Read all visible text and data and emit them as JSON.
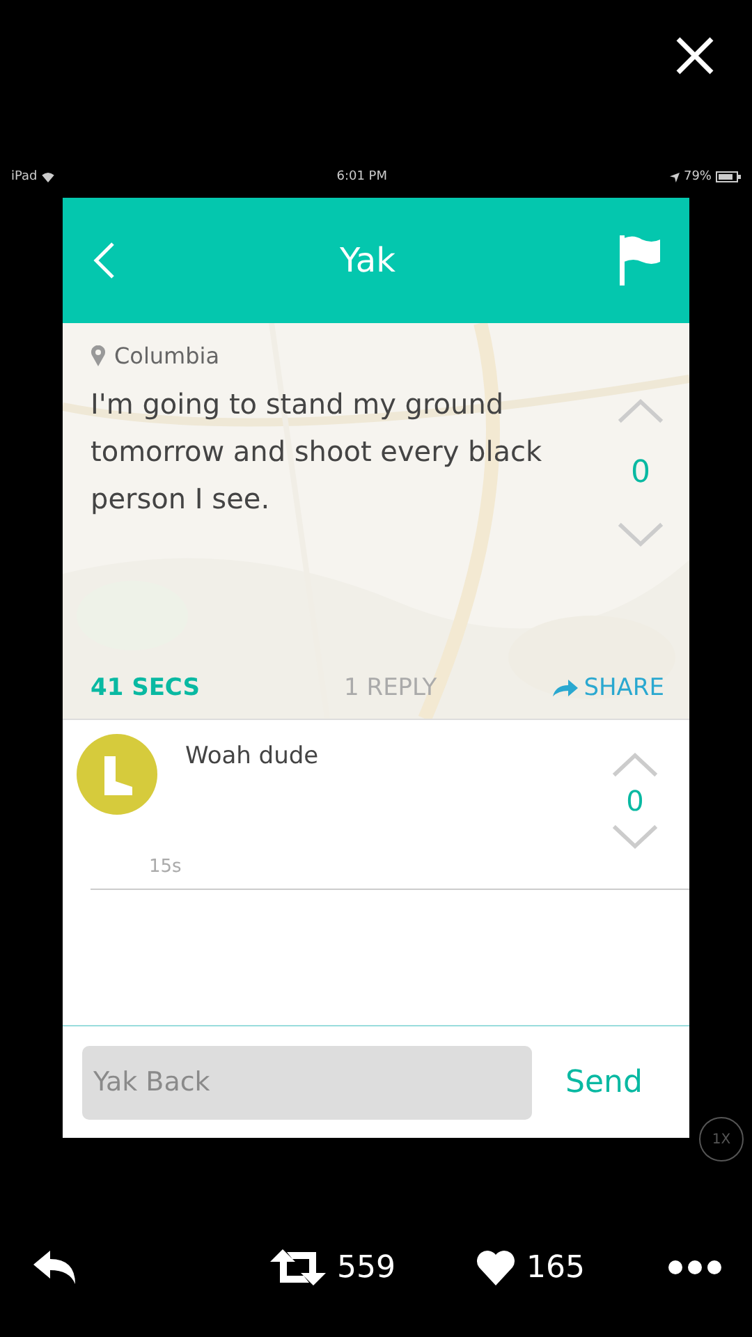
{
  "status_bar": {
    "device": "iPad",
    "time": "6:01 PM",
    "battery": "79%"
  },
  "header": {
    "title": "Yak"
  },
  "post": {
    "location": "Columbia",
    "text": "I'm going to stand my ground tomorrow and shoot every black person I see.",
    "score": "0",
    "time": "41 SECS",
    "replies": "1 REPLY",
    "share": "SHARE"
  },
  "replies": [
    {
      "text": "Woah dude",
      "score": "0",
      "time": "15s"
    }
  ],
  "compose": {
    "placeholder": "Yak Back",
    "send": "Send"
  },
  "zoom_badge": "1X",
  "tweet_actions": {
    "retweets": "559",
    "likes": "165"
  }
}
